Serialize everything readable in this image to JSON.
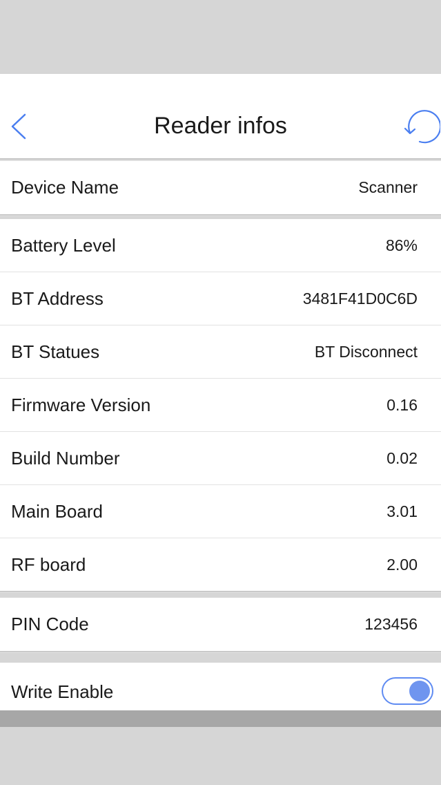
{
  "header": {
    "title": "Reader infos"
  },
  "icons": {
    "back": "chevron-left-icon",
    "refresh": "refresh-icon"
  },
  "colors": {
    "accent": "#4a7ef0",
    "toggle_on": "#6f95ef"
  },
  "section1": {
    "rows": [
      {
        "label": "Device Name",
        "value": "Scanner"
      }
    ]
  },
  "section2": {
    "rows": [
      {
        "label": "Battery Level",
        "value": "86%"
      },
      {
        "label": "BT Address",
        "value": "3481F41D0C6D"
      },
      {
        "label": "BT Statues",
        "value": "BT Disconnect"
      },
      {
        "label": "Firmware Version",
        "value": "0.16"
      },
      {
        "label": "Build Number",
        "value": "0.02"
      },
      {
        "label": "Main Board",
        "value": "3.01"
      },
      {
        "label": "RF board",
        "value": "2.00"
      }
    ]
  },
  "section3": {
    "rows": [
      {
        "label": "PIN Code",
        "value": "123456"
      }
    ]
  },
  "section4": {
    "write_enable_label": "Write Enable",
    "write_enable_on": true
  }
}
